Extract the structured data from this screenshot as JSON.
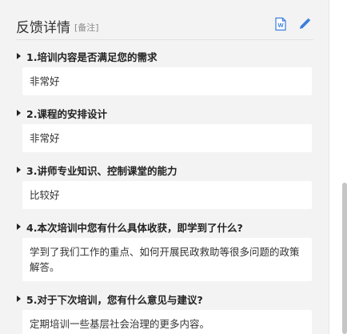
{
  "header": {
    "title": "反馈详情",
    "note": "[备注]",
    "export_icon": "word-document-icon",
    "edit_icon": "pencil-edit-icon"
  },
  "items": [
    {
      "question": "1.培训内容是否满足您的需求",
      "answer": "非常好"
    },
    {
      "question": "2.课程的安排设计",
      "answer": "非常好"
    },
    {
      "question": "3.讲师专业知识、控制课堂的能力",
      "answer": "比较好"
    },
    {
      "question": "4.本次培训中您有什么具体收获，即学到了什么?",
      "answer": "学到了我们工作的重点、如何开展民政救助等很多问题的政策解答。"
    },
    {
      "question": "5.对于下次培训，您有什么意见与建议?",
      "answer": "定期培训一些基层社会治理的更多内容。"
    }
  ],
  "colors": {
    "panel_bg": "#f3f3f3",
    "card_bg": "#ffffff",
    "accent_blue": "#3b7ddd"
  }
}
